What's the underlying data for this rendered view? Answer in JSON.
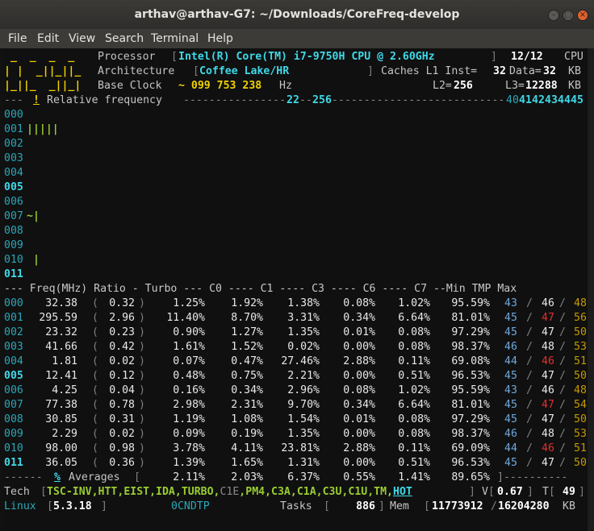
{
  "window": {
    "title": "arthav@arthav-G7: ~/Downloads/CoreFreq-develop"
  },
  "menu": [
    "File",
    "Edit",
    "View",
    "Search",
    "Terminal",
    "Help"
  ],
  "header": {
    "logo": [
      " _  _  _  _ ",
      "| |  _||_||_",
      "|_||_  _||_|"
    ],
    "processor_label": "Processor",
    "processor": "Intel(R) Core(TM) i7-9750H CPU @ 2.60GHz",
    "cpu_count": "12/12",
    "cpu_label": "CPU",
    "arch_label": "Architecture",
    "arch": "Coffee Lake/HR",
    "caches_label": "Caches L1 Inst=",
    "l1_inst": "32",
    "data_label": "Data=",
    "l1_data": "32",
    "kb": "KB",
    "clock_label": "Base Clock",
    "clock": "~ 099 753 238",
    "hz": "Hz",
    "l2_label": "L2=",
    "l2": "256",
    "l3_label": "L3=",
    "l3": "12288",
    "kb2": "KB"
  },
  "rel_freq": {
    "bang": "!",
    "label": "Relative frequency",
    "ratios": [
      "22",
      "25",
      "6",
      "40",
      "41",
      "42",
      "43",
      "44",
      "45"
    ]
  },
  "graph": [
    {
      "id": "000",
      "bar": ""
    },
    {
      "id": "001",
      "bar": "|||||"
    },
    {
      "id": "002",
      "bar": ""
    },
    {
      "id": "003",
      "bar": ""
    },
    {
      "id": "004",
      "bar": ""
    },
    {
      "id": "005",
      "bar": ""
    },
    {
      "id": "006",
      "bar": ""
    },
    {
      "id": "007",
      "bar": "~|"
    },
    {
      "id": "008",
      "bar": ""
    },
    {
      "id": "009",
      "bar": ""
    },
    {
      "id": "010",
      "bar": " |"
    },
    {
      "id": "011",
      "bar": ""
    }
  ],
  "table_header": "--- Freq(MHz) Ratio - Turbo --- C0 ---- C1 ---- C3 ---- C6 ---- C7 --Min TMP Max",
  "rows": [
    {
      "id": "000",
      "freq": "32.38",
      "ratio": "0.32",
      "turbo": "1.25%",
      "c0": "1.92%",
      "c1": "1.38%",
      "c3": "0.08%",
      "c6": "1.02%",
      "c7": "95.59%",
      "min": "43",
      "tmp": "46",
      "max": "48",
      "hot": false
    },
    {
      "id": "001",
      "freq": "295.59",
      "ratio": "2.96",
      "turbo": "11.40%",
      "c0": "8.70%",
      "c1": "3.31%",
      "c3": "0.34%",
      "c6": "6.64%",
      "c7": "81.01%",
      "min": "45",
      "tmp": "47",
      "max": "56",
      "hot": true
    },
    {
      "id": "002",
      "freq": "23.32",
      "ratio": "0.23",
      "turbo": "0.90%",
      "c0": "1.27%",
      "c1": "1.35%",
      "c3": "0.01%",
      "c6": "0.08%",
      "c7": "97.29%",
      "min": "45",
      "tmp": "47",
      "max": "50",
      "hot": false
    },
    {
      "id": "003",
      "freq": "41.66",
      "ratio": "0.42",
      "turbo": "1.61%",
      "c0": "1.52%",
      "c1": "0.02%",
      "c3": "0.00%",
      "c6": "0.08%",
      "c7": "98.37%",
      "min": "46",
      "tmp": "48",
      "max": "53",
      "hot": false
    },
    {
      "id": "004",
      "freq": "1.81",
      "ratio": "0.02",
      "turbo": "0.07%",
      "c0": "0.47%",
      "c1": "27.46%",
      "c3": "2.88%",
      "c6": "0.11%",
      "c7": "69.08%",
      "min": "44",
      "tmp": "46",
      "max": "51",
      "hot": true
    },
    {
      "id": "005",
      "freq": "12.41",
      "ratio": "0.12",
      "turbo": "0.48%",
      "c0": "0.75%",
      "c1": "2.21%",
      "c3": "0.00%",
      "c6": "0.51%",
      "c7": "96.53%",
      "min": "45",
      "tmp": "47",
      "max": "50",
      "hot": false
    },
    {
      "id": "006",
      "freq": "4.25",
      "ratio": "0.04",
      "turbo": "0.16%",
      "c0": "0.34%",
      "c1": "2.96%",
      "c3": "0.08%",
      "c6": "1.02%",
      "c7": "95.59%",
      "min": "43",
      "tmp": "46",
      "max": "48",
      "hot": false
    },
    {
      "id": "007",
      "freq": "77.38",
      "ratio": "0.78",
      "turbo": "2.98%",
      "c0": "2.31%",
      "c1": "9.70%",
      "c3": "0.34%",
      "c6": "6.64%",
      "c7": "81.01%",
      "min": "45",
      "tmp": "47",
      "max": "54",
      "hot": true
    },
    {
      "id": "008",
      "freq": "30.85",
      "ratio": "0.31",
      "turbo": "1.19%",
      "c0": "1.08%",
      "c1": "1.54%",
      "c3": "0.01%",
      "c6": "0.08%",
      "c7": "97.29%",
      "min": "45",
      "tmp": "47",
      "max": "50",
      "hot": false
    },
    {
      "id": "009",
      "freq": "2.29",
      "ratio": "0.02",
      "turbo": "0.09%",
      "c0": "0.19%",
      "c1": "1.35%",
      "c3": "0.00%",
      "c6": "0.08%",
      "c7": "98.37%",
      "min": "46",
      "tmp": "48",
      "max": "53",
      "hot": false
    },
    {
      "id": "010",
      "freq": "98.00",
      "ratio": "0.98",
      "turbo": "3.78%",
      "c0": "4.11%",
      "c1": "23.81%",
      "c3": "2.88%",
      "c6": "0.11%",
      "c7": "69.09%",
      "min": "44",
      "tmp": "46",
      "max": "51",
      "hot": true
    },
    {
      "id": "011",
      "freq": "36.05",
      "ratio": "0.36",
      "turbo": "1.39%",
      "c0": "1.65%",
      "c1": "1.31%",
      "c3": "0.00%",
      "c6": "0.51%",
      "c7": "96.53%",
      "min": "45",
      "tmp": "47",
      "max": "50",
      "hot": false
    }
  ],
  "averages": {
    "prefix": "------",
    "pct": "%",
    "label": "Averages",
    "turbo": "2.11%",
    "c0": "2.03%",
    "c1": "6.37%",
    "c3": "0.55%",
    "c6": "1.41%",
    "c7": "89.65%"
  },
  "tech": {
    "label": "Tech",
    "flags": [
      "TSC-INV",
      "HTT",
      "EIST",
      "IDA",
      "TURBO",
      "C1E",
      "PM4",
      "C3A",
      "C1A",
      "C3U",
      "C1U",
      "TM",
      "HOT"
    ],
    "v_label": "V",
    "voltage": "0.67",
    "t_label": "T",
    "temp": "49"
  },
  "status": {
    "os": "Linux",
    "kernel": "5.3.18",
    "mask": "0CNDTP",
    "tasks_label": "Tasks",
    "tasks": "886",
    "mem_label": "Mem",
    "mem_used": "11773912",
    "mem_total": "16204280",
    "mem_unit": "KB"
  }
}
